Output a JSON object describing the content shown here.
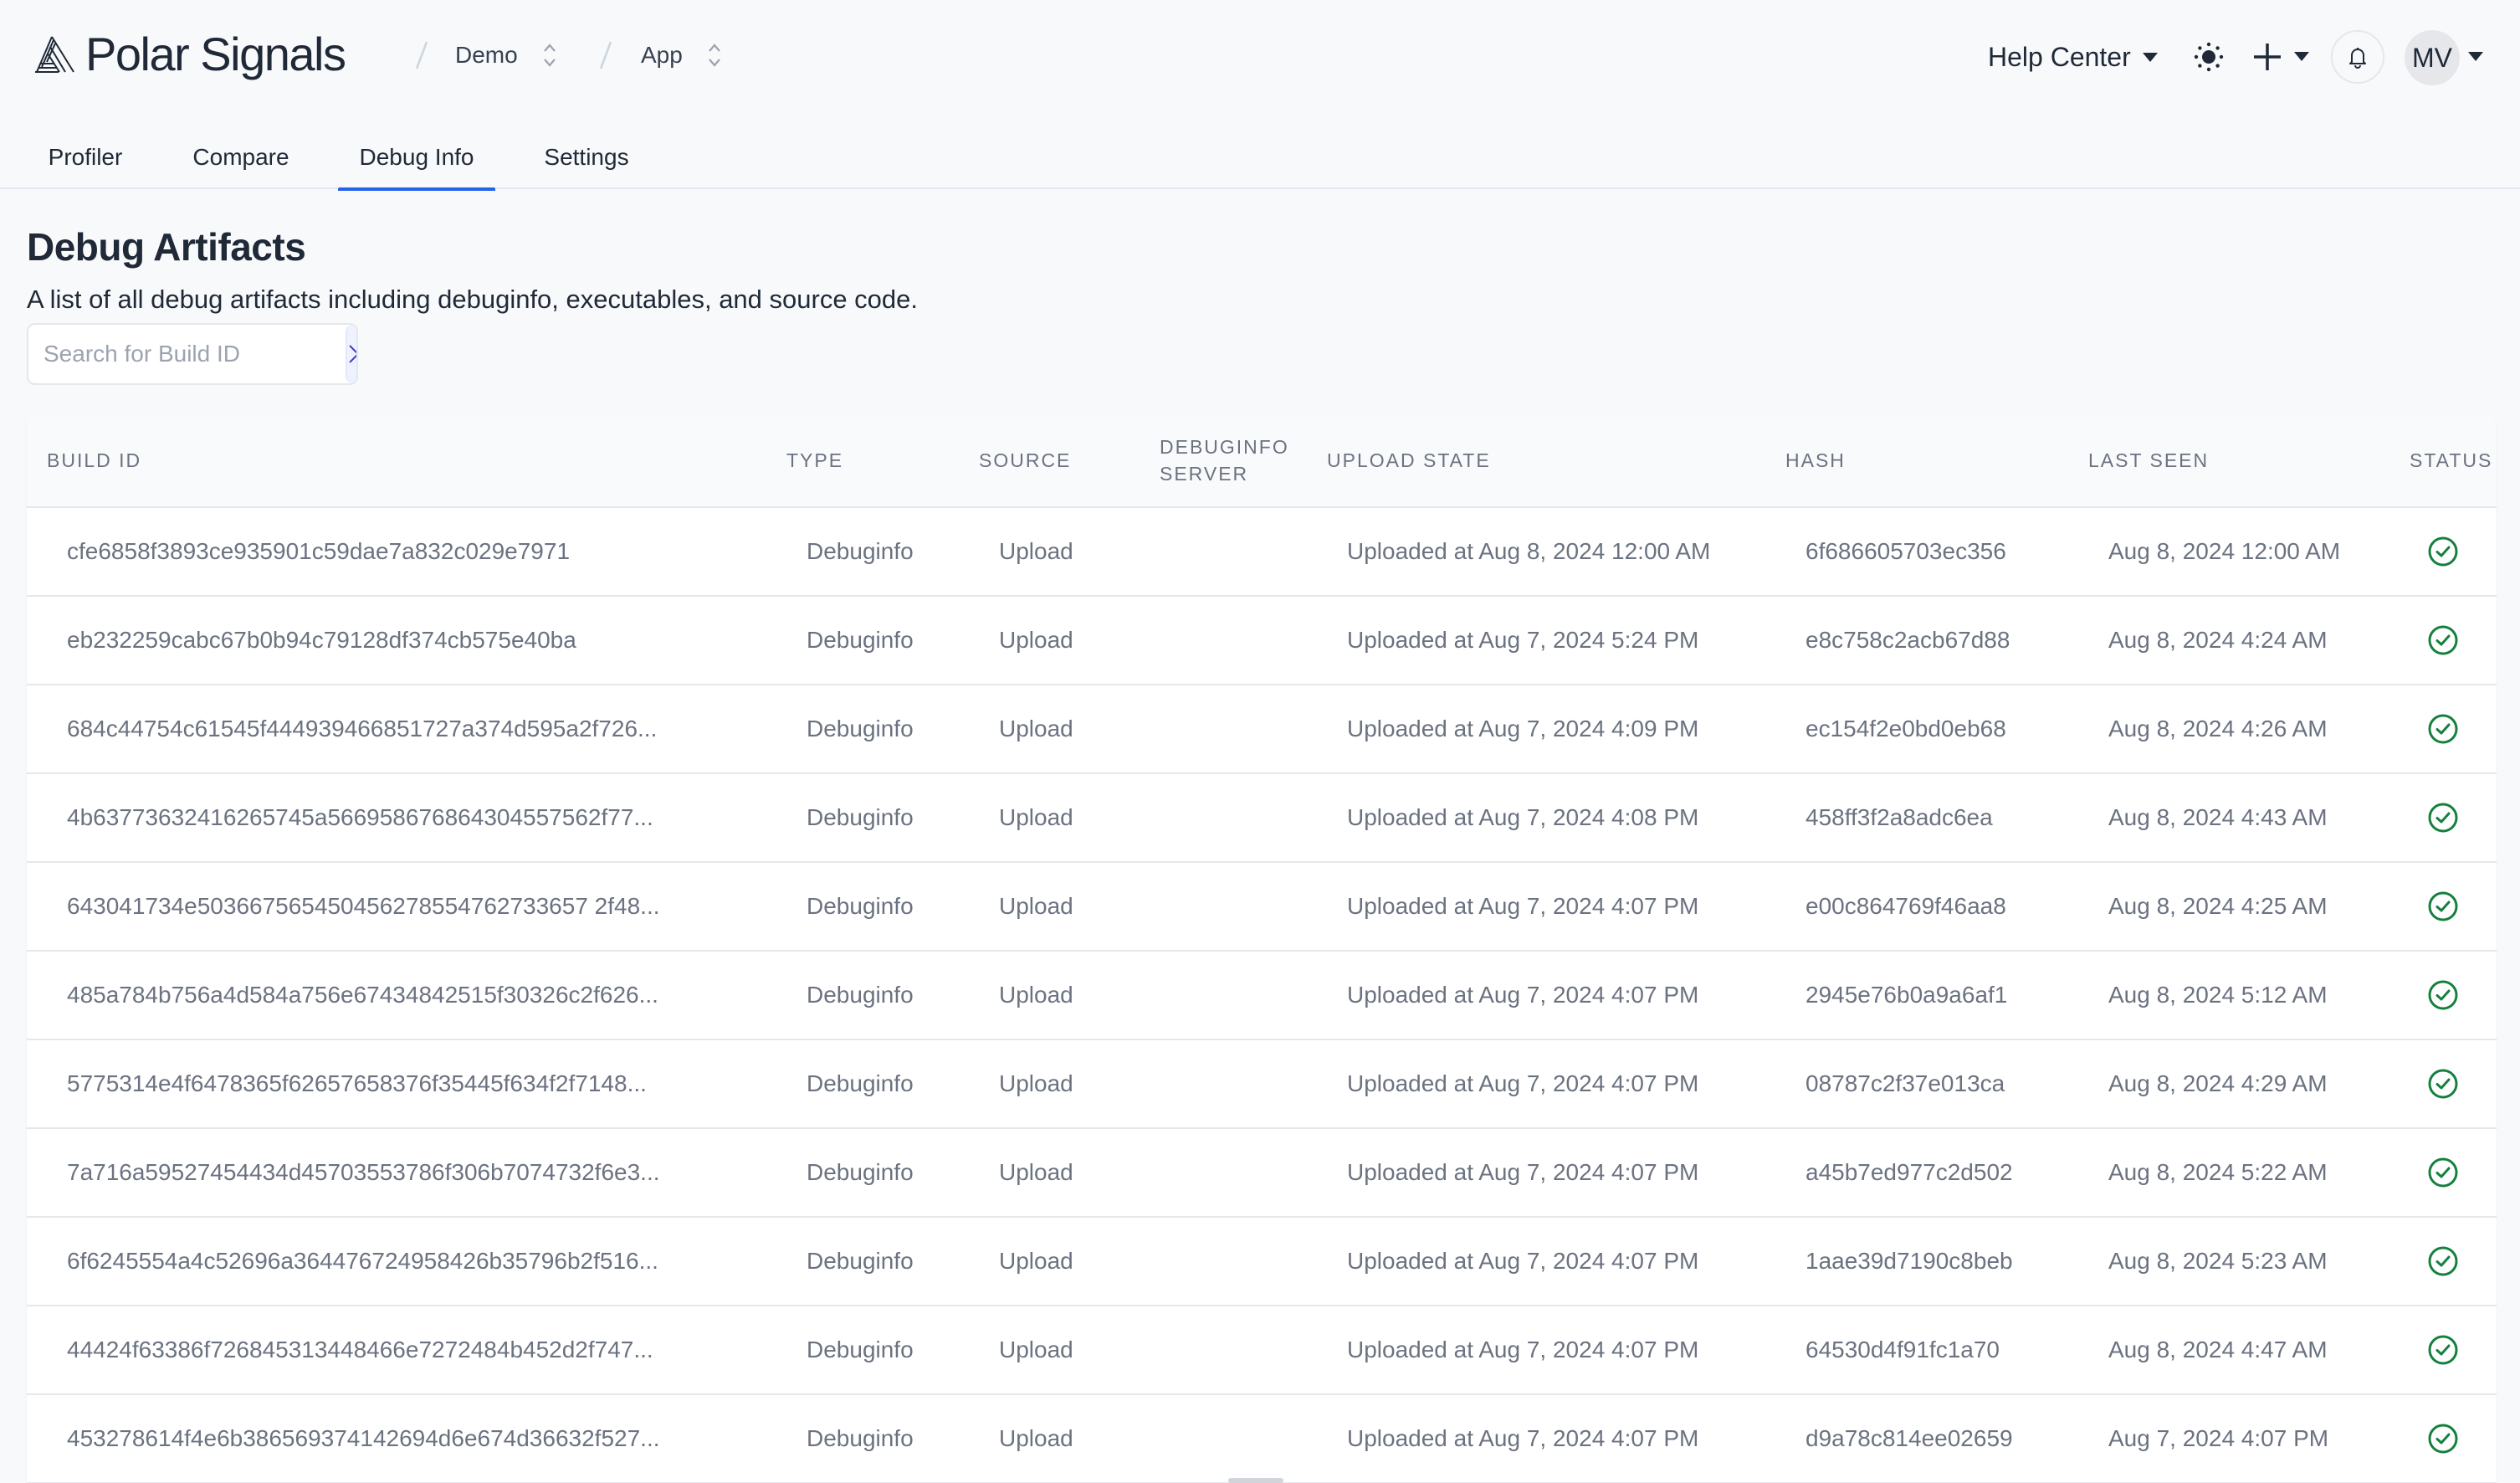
{
  "header": {
    "brand": "Polar Signals",
    "breadcrumbs": [
      {
        "label": "Demo",
        "icon": "chevron-up-down-icon"
      },
      {
        "label": "App",
        "icon": "chevron-up-down-icon"
      }
    ],
    "help_center": "Help Center",
    "theme_icon": "sun-icon",
    "add_icon": "plus-icon",
    "notifications_icon": "bell-icon",
    "avatar_initials": "MV"
  },
  "tabs": [
    {
      "label": "Profiler",
      "active": false
    },
    {
      "label": "Compare",
      "active": false
    },
    {
      "label": "Debug Info",
      "active": true
    },
    {
      "label": "Settings",
      "active": false
    }
  ],
  "page": {
    "title": "Debug Artifacts",
    "description": "A list of all debug artifacts including debuginfo, executables, and source code.",
    "search": {
      "placeholder": "Search for Build ID",
      "value": "",
      "button_icon": "chevron-right-icon"
    }
  },
  "colors": {
    "accent": "#2563eb",
    "status_ok": "#15803d",
    "search_button_bg": "#eef2ff",
    "search_icon": "#4338ca"
  },
  "table": {
    "columns": [
      "Build ID",
      "Type",
      "Source",
      "Debuginfo Server",
      "Upload State",
      "Hash",
      "Last Seen",
      "Status"
    ],
    "rows": [
      {
        "build_id": "cfe6858f3893ce935901c59dae7a832c029e7971",
        "type": "Debuginfo",
        "source": "Upload",
        "debuginfo_server": "",
        "upload_state": "Uploaded at Aug 8, 2024 12:00 AM",
        "hash": "6f686605703ec356",
        "last_seen": "Aug 8, 2024 12:00 AM",
        "status": "success"
      },
      {
        "build_id": "eb232259cabc67b0b94c79128df374cb575e40ba",
        "type": "Debuginfo",
        "source": "Upload",
        "debuginfo_server": "",
        "upload_state": "Uploaded at Aug 7, 2024 5:24 PM",
        "hash": "e8c758c2acb67d88",
        "last_seen": "Aug 8, 2024 4:24 AM",
        "status": "success"
      },
      {
        "build_id": "684c44754c61545f444939466851727a374d595a2f726...",
        "type": "Debuginfo",
        "source": "Upload",
        "debuginfo_server": "",
        "upload_state": "Uploaded at Aug 7, 2024 4:09 PM",
        "hash": "ec154f2e0bd0eb68",
        "last_seen": "Aug 8, 2024 4:26 AM",
        "status": "success"
      },
      {
        "build_id": "4b63773632416265745a566958676864304557562f77...",
        "type": "Debuginfo",
        "source": "Upload",
        "debuginfo_server": "",
        "upload_state": "Uploaded at Aug 7, 2024 4:08 PM",
        "hash": "458ff3f2a8adc6ea",
        "last_seen": "Aug 8, 2024 4:43 AM",
        "status": "success"
      },
      {
        "build_id": "643041734e503667565450456278554762733657 2f48...",
        "type": "Debuginfo",
        "source": "Upload",
        "debuginfo_server": "",
        "upload_state": "Uploaded at Aug 7, 2024 4:07 PM",
        "hash": "e00c864769f46aa8",
        "last_seen": "Aug 8, 2024 4:25 AM",
        "status": "success"
      },
      {
        "build_id": "485a784b756a4d584a756e67434842515f30326c2f626...",
        "type": "Debuginfo",
        "source": "Upload",
        "debuginfo_server": "",
        "upload_state": "Uploaded at Aug 7, 2024 4:07 PM",
        "hash": "2945e76b0a9a6af1",
        "last_seen": "Aug 8, 2024 5:12 AM",
        "status": "success"
      },
      {
        "build_id": "5775314e4f6478365f62657658376f35445f634f2f7148...",
        "type": "Debuginfo",
        "source": "Upload",
        "debuginfo_server": "",
        "upload_state": "Uploaded at Aug 7, 2024 4:07 PM",
        "hash": "08787c2f37e013ca",
        "last_seen": "Aug 8, 2024 4:29 AM",
        "status": "success"
      },
      {
        "build_id": "7a716a59527454434d45703553786f306b7074732f6e3...",
        "type": "Debuginfo",
        "source": "Upload",
        "debuginfo_server": "",
        "upload_state": "Uploaded at Aug 7, 2024 4:07 PM",
        "hash": "a45b7ed977c2d502",
        "last_seen": "Aug 8, 2024 5:22 AM",
        "status": "success"
      },
      {
        "build_id": "6f6245554a4c52696a364476724958426b35796b2f516...",
        "type": "Debuginfo",
        "source": "Upload",
        "debuginfo_server": "",
        "upload_state": "Uploaded at Aug 7, 2024 4:07 PM",
        "hash": "1aae39d7190c8beb",
        "last_seen": "Aug 8, 2024 5:23 AM",
        "status": "success"
      },
      {
        "build_id": "44424f63386f726845313448466e7272484b452d2f747...",
        "type": "Debuginfo",
        "source": "Upload",
        "debuginfo_server": "",
        "upload_state": "Uploaded at Aug 7, 2024 4:07 PM",
        "hash": "64530d4f91fc1a70",
        "last_seen": "Aug 8, 2024 4:47 AM",
        "status": "success"
      },
      {
        "build_id": "453278614f4e6b386569374142694d6e674d36632f527...",
        "type": "Debuginfo",
        "source": "Upload",
        "debuginfo_server": "",
        "upload_state": "Uploaded at Aug 7, 2024 4:07 PM",
        "hash": "d9a78c814ee02659",
        "last_seen": "Aug 7, 2024 4:07 PM",
        "status": "success"
      }
    ]
  }
}
